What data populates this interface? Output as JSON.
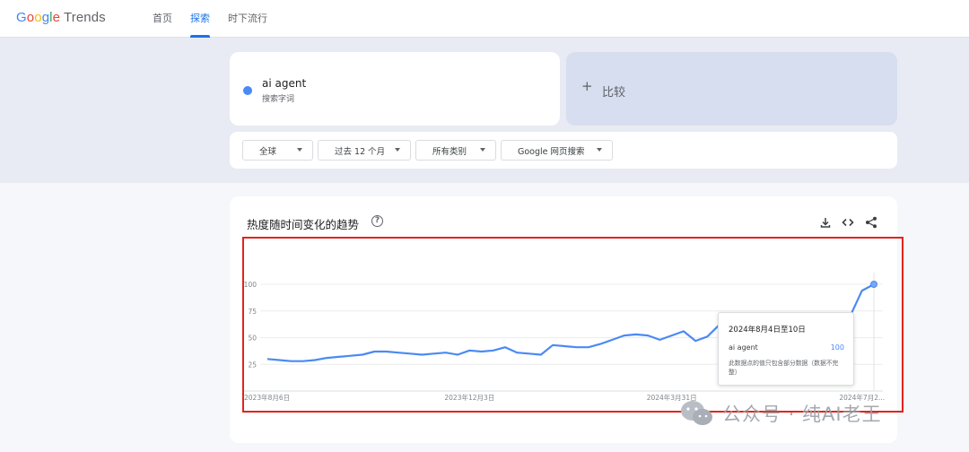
{
  "header": {
    "logo": {
      "google": [
        "G",
        "o",
        "o",
        "g",
        "l",
        "e"
      ],
      "trends": "Trends"
    },
    "nav": [
      {
        "label": "首页"
      },
      {
        "label": "探索"
      },
      {
        "label": "时下流行"
      }
    ]
  },
  "search": {
    "term": "ai agent",
    "term_type": "搜索字词",
    "compare_label": "比较"
  },
  "filters": [
    {
      "label": "全球"
    },
    {
      "label": "过去 12 个月"
    },
    {
      "label": "所有类别"
    },
    {
      "label": "Google 网页搜索"
    }
  ],
  "chart_card": {
    "title": "热度随时间变化的趋势",
    "help_glyph": "?"
  },
  "chart_data": {
    "type": "line",
    "series": [
      {
        "name": "ai agent",
        "color": "#4a8af4",
        "values": [
          30,
          29,
          28,
          28,
          29,
          31,
          32,
          33,
          34,
          37,
          37,
          36,
          35,
          34,
          35,
          36,
          34,
          38,
          37,
          38,
          41,
          36,
          35,
          34,
          43,
          42,
          41,
          41,
          44,
          48,
          52,
          53,
          52,
          48,
          52,
          56,
          47,
          51,
          62,
          67,
          65,
          61,
          62,
          64,
          66,
          58,
          59,
          62,
          64,
          70,
          94,
          100
        ]
      }
    ],
    "x_tick_labels": [
      "2023年8月6日",
      "2023年12月3日",
      "2024年3月31日",
      "2024年7月2..."
    ],
    "y_tick_labels": [
      "100",
      "75",
      "50",
      "25"
    ],
    "ylim": [
      0,
      100
    ]
  },
  "tooltip": {
    "date": "2024年8月4日至10日",
    "term": "ai agent",
    "value": "100",
    "note": "此数据点的值只包含部分数据（数据不完整）"
  },
  "watermark": {
    "text": "公众号 · 纯AI老王"
  }
}
